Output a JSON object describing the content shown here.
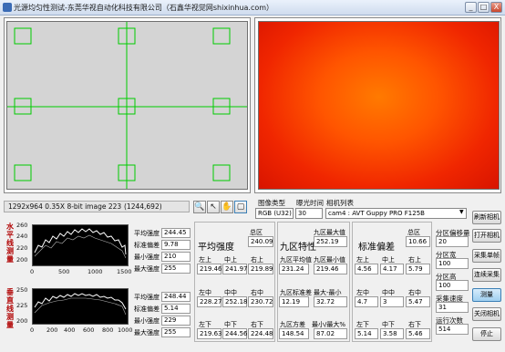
{
  "window": {
    "title": "光源均匀性测试-东莞华视自动化科技有限公司（石鑫华视觉网shixinhua.com）",
    "controls": [
      "_",
      "□",
      "X"
    ]
  },
  "image_status": {
    "info": "1292x964 0.35X 8-bit image 223",
    "coords": "(1244,692)"
  },
  "camera": {
    "image_type_label": "图像类型",
    "exposure_label": "曝光时间",
    "camera_list_label": "相机列表",
    "image_type_value": "RGB (U32)",
    "exposure_value": "30",
    "camera_value": "cam4 : AVT Guppy PRO F125B"
  },
  "horizontal": {
    "label": "水平线测量",
    "y_ticks": [
      "260",
      "240",
      "220",
      "200"
    ],
    "x_ticks": [
      "0",
      "500",
      "1000",
      "1500"
    ],
    "avg_label": "平均强度",
    "avg": "244.45",
    "std_label": "标准偏差",
    "std": "9.78",
    "min_label": "最小强度",
    "min": "210",
    "max_label": "最大强度",
    "max": "255"
  },
  "vertical": {
    "label": "垂直线测量",
    "y_ticks": [
      "250",
      "225",
      "200"
    ],
    "x_ticks": [
      "0",
      "200",
      "400",
      "600",
      "800",
      "1000"
    ],
    "avg_label": "平均强度",
    "avg": "248.44",
    "std_label": "标准偏差",
    "std": "5.14",
    "min_label": "最小强度",
    "min": "229",
    "max_label": "最大强度",
    "max": "255"
  },
  "avg_intensity": {
    "title": "平均强度",
    "total_label": "总区",
    "total": "240.09",
    "cells": [
      {
        "label": "左上",
        "value": "219.46"
      },
      {
        "label": "中上",
        "value": "241.97"
      },
      {
        "label": "右上",
        "value": "219.89"
      },
      {
        "label": "左中",
        "value": "228.27"
      },
      {
        "label": "中中",
        "value": "252.18"
      },
      {
        "label": "右中",
        "value": "230.72"
      },
      {
        "label": "左下",
        "value": "219.63"
      },
      {
        "label": "中下",
        "value": "244.56"
      },
      {
        "label": "右下",
        "value": "224.48"
      }
    ]
  },
  "nine_zone": {
    "title": "九区特性",
    "max_label": "九区最大值",
    "max": "252.19",
    "avg_label": "九区平均值",
    "avg": "231.24",
    "min_label": "九区最小值",
    "min": "219.46",
    "std_label": "九区标准差",
    "std": "12.19",
    "range_label": "最大-最小",
    "range": "32.72",
    "var_label": "九区方差",
    "var": "148.54",
    "ratio_label": "最小/最大%",
    "ratio": "87.02"
  },
  "std_dev": {
    "title": "标准偏差",
    "total_label": "总区",
    "total": "10.66",
    "cells": [
      {
        "label": "左上",
        "value": "4.56"
      },
      {
        "label": "中上",
        "value": "4.17"
      },
      {
        "label": "右上",
        "value": "5.79"
      },
      {
        "label": "左中",
        "value": "4.7"
      },
      {
        "label": "中中",
        "value": "3"
      },
      {
        "label": "右中",
        "value": "5.47"
      },
      {
        "label": "左下",
        "value": "5.14"
      },
      {
        "label": "中下",
        "value": "3.58"
      },
      {
        "label": "右下",
        "value": "5.46"
      }
    ]
  },
  "settings": {
    "offset_label": "分区偏移量",
    "offset": "20",
    "width_label": "分区宽",
    "width": "100",
    "height_label": "分区高",
    "height": "100",
    "speed_label": "采集速度",
    "speed": "31",
    "count_label": "运行次数",
    "count": "514"
  },
  "buttons": {
    "refresh": "刷新相机",
    "open": "打开相机",
    "single": "采集单帧",
    "continuous": "连续采集",
    "measure": "测量",
    "close": "关闭相机",
    "stop": "停止"
  },
  "colors": {
    "grid_line": "#00cc00",
    "plot_trace": "#ffffff",
    "plot_bg": "#000000",
    "heatmap_center": "#ff7a00",
    "heatmap_edge": "#d81400"
  }
}
